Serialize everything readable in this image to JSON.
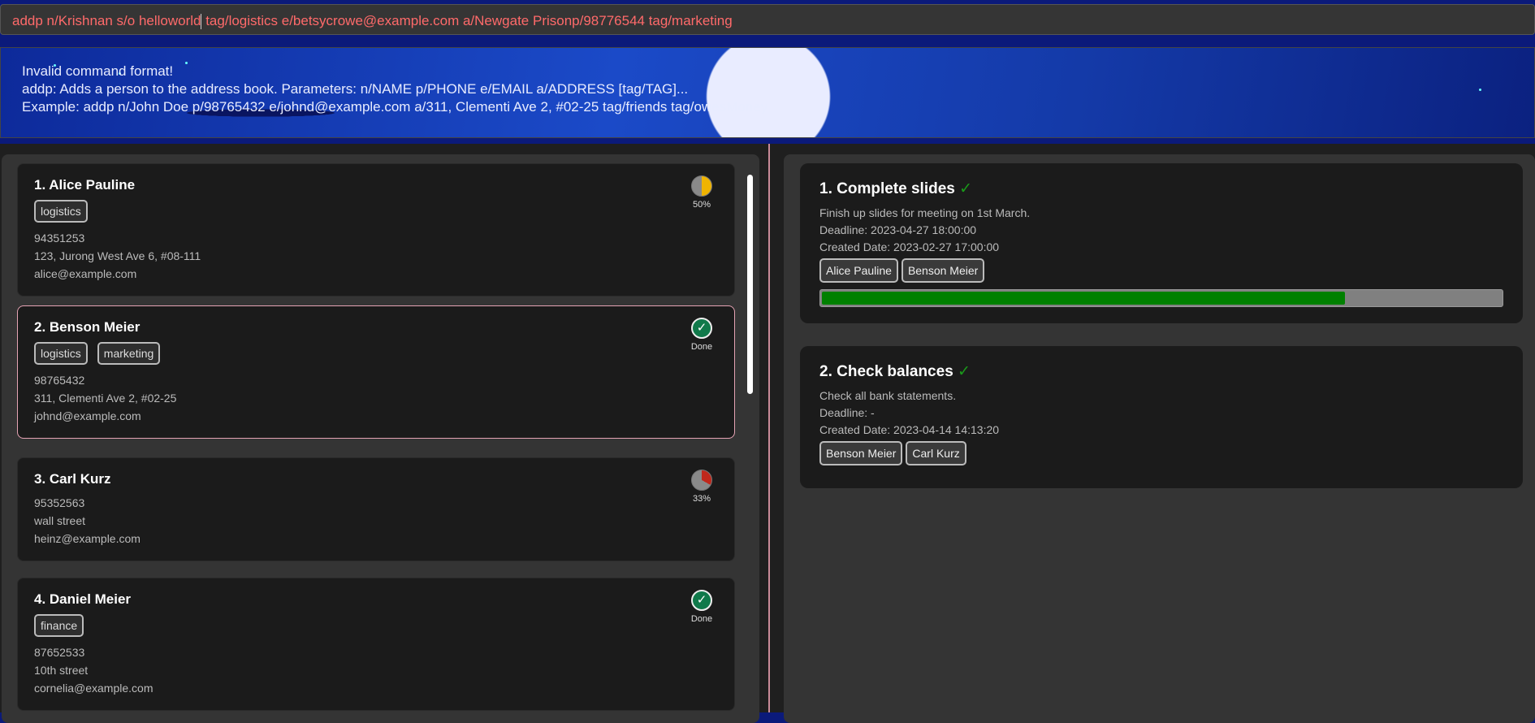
{
  "command": {
    "before_caret": "addp n/Krishnan s/o helloworld",
    "after_caret": " tag/logistics e/betsycrowe@example.com a/Newgate Prisonp/98776544 tag/marketing"
  },
  "result": [
    "Invalid command format!",
    "addp: Adds a person to the address book. Parameters: n/NAME p/PHONE e/EMAIL a/ADDRESS [tag/TAG]...",
    "Example: addp n/John Doe p/98765432 e/johnd@example.com a/311, Clementi Ave 2, #02-25 tag/friends tag/owesMoney"
  ],
  "persons": [
    {
      "name": "1.  Alice Pauline",
      "tags": [
        "logistics"
      ],
      "phone": "94351253",
      "address": "123, Jurong West Ave 6, #08-111",
      "email": "alice@example.com",
      "status": "50%",
      "progress": 50,
      "color": "#f0b400"
    },
    {
      "name": "2.  Benson Meier",
      "tags": [
        "logistics",
        "marketing"
      ],
      "phone": "98765432",
      "address": "311, Clementi Ave 2, #02-25",
      "email": "johnd@example.com",
      "status": "Done",
      "progress": 100
    },
    {
      "name": "3.  Carl Kurz",
      "tags": [],
      "phone": "95352563",
      "address": "wall street",
      "email": "heinz@example.com",
      "status": "33%",
      "progress": 33,
      "color": "#c0281c"
    },
    {
      "name": "4.  Daniel Meier",
      "tags": [
        "finance"
      ],
      "phone": "87652533",
      "address": "10th street",
      "email": "cornelia@example.com",
      "status": "Done",
      "progress": 100
    }
  ],
  "tasks": [
    {
      "title": "1.  Complete slides",
      "check": "✓",
      "description": "Finish up slides for meeting on 1st March.",
      "deadline": "Deadline: 2023-04-27 18:00:00",
      "created": "Created Date: 2023-02-27 17:00:00",
      "assignees": [
        "Alice Pauline",
        "Benson Meier"
      ],
      "progress": 77
    },
    {
      "title": "2.  Check balances",
      "check": "✓",
      "description": "Check all bank statements.",
      "deadline": "Deadline: -",
      "created": "Created Date: 2023-04-14 14:13:20",
      "assignees": [
        "Benson Meier",
        "Carl Kurz"
      ]
    }
  ]
}
